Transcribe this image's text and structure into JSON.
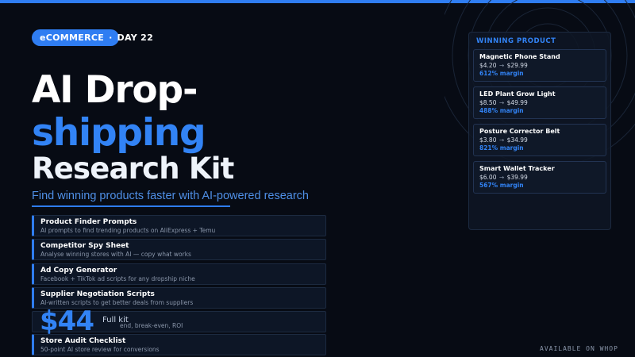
{
  "badge": {
    "category": "eCOMMERCE",
    "separator": "·",
    "day": "DAY 22"
  },
  "headline": {
    "line1": "AI Drop-",
    "line2": "shipping",
    "line3": "Research Kit"
  },
  "subtitle": "Find winning products faster with AI-powered research",
  "features": [
    {
      "title": "Product Finder Prompts",
      "desc": "AI prompts to find trending products on AliExpress + Temu"
    },
    {
      "title": "Competitor Spy Sheet",
      "desc": "Analyse winning stores with AI — copy what works"
    },
    {
      "title": "Ad Copy Generator",
      "desc": "Facebook + TikTok ad scripts for any dropship niche"
    },
    {
      "title": "Supplier Negotiation Scripts",
      "desc": "AI-written scripts to get better deals from suppliers"
    },
    {
      "title": "",
      "desc": "end, break-even, ROI"
    },
    {
      "title": "Store Audit Checklist",
      "desc": "50-point AI store review for conversions"
    }
  ],
  "price": {
    "amount": "$44",
    "label": "Full kit"
  },
  "panel": {
    "title": "WINNING PRODUCT",
    "arrow": "→",
    "products": [
      {
        "name": "Magnetic Phone Stand",
        "cost": "$4.20",
        "sell": "$29.99",
        "margin": "612% margin"
      },
      {
        "name": "LED Plant Grow Light",
        "cost": "$8.50",
        "sell": "$49.99",
        "margin": "488% margin"
      },
      {
        "name": "Posture Corrector Belt",
        "cost": "$3.80",
        "sell": "$34.99",
        "margin": "821% margin"
      },
      {
        "name": "Smart Wallet Tracker",
        "cost": "$6.00",
        "sell": "$39.99",
        "margin": "567% margin"
      }
    ]
  },
  "footer": "AVAILABLE ON WHOP",
  "colors": {
    "accent": "#2f7df2",
    "background": "#070b14",
    "panel": "#0f1828"
  }
}
